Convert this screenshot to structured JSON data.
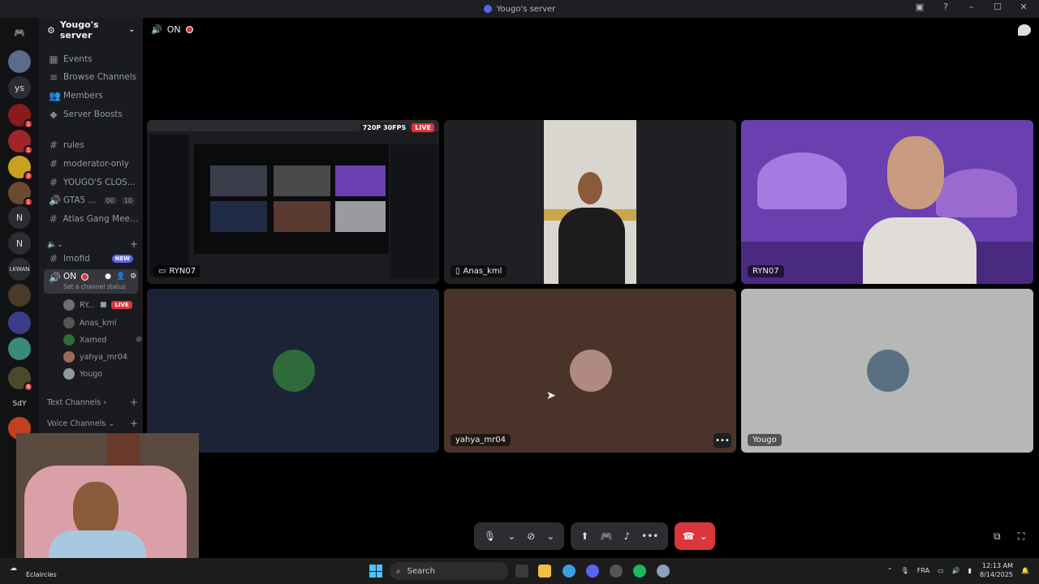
{
  "window": {
    "title": "Yougo's server"
  },
  "server": {
    "name": "Yougo's server"
  },
  "sidebar": {
    "nav": [
      "Events",
      "Browse Channels",
      "Members",
      "Server Boosts"
    ],
    "channels": [
      {
        "name": "rules",
        "type": "text"
      },
      {
        "name": "moderator-only",
        "type": "text"
      },
      {
        "name": "YOUGO'S CLOS...",
        "type": "text"
      },
      {
        "name": "GTA5 ...",
        "type": "voice",
        "count_a": "00",
        "count_b": "10"
      },
      {
        "name": "Atlas Gang Mee...",
        "type": "text"
      }
    ],
    "lmofid": {
      "name": "lmofid",
      "badge": "NEW"
    },
    "active_voice": {
      "name": "ON",
      "status": "Set a channel status"
    },
    "voice_users": [
      {
        "name": "RY...",
        "badge": "LIVE"
      },
      {
        "name": "Anas_kml"
      },
      {
        "name": "Xamed"
      },
      {
        "name": "yahya_mr04"
      },
      {
        "name": "Yougo"
      }
    ],
    "categories": [
      "Text Channels",
      "Voice Channels"
    ]
  },
  "guilds": [
    {
      "label": "ys"
    },
    {
      "label": "N"
    },
    {
      "label": "N"
    },
    {
      "label": "LKWAN"
    },
    {
      "label": "SdY"
    }
  ],
  "guild_badges": [
    "1",
    "1",
    "3",
    "1",
    "8"
  ],
  "stage": {
    "channel_label": "ON",
    "tiles": [
      {
        "name": "RYN07",
        "resolution": "720P 30FPS",
        "live": "LIVE"
      },
      {
        "name": "Anas_kml"
      },
      {
        "name": "RYN07"
      },
      {
        "name": ""
      },
      {
        "name": "yahya_mr04"
      },
      {
        "name": "Yougo"
      }
    ]
  },
  "taskbar": {
    "weather": "Eclaircies",
    "search_placeholder": "Search",
    "lang": "FRA",
    "time": "12:13 AM",
    "date": "8/14/2025"
  },
  "colors": {
    "accent": "#5865f2",
    "danger": "#da373c"
  }
}
